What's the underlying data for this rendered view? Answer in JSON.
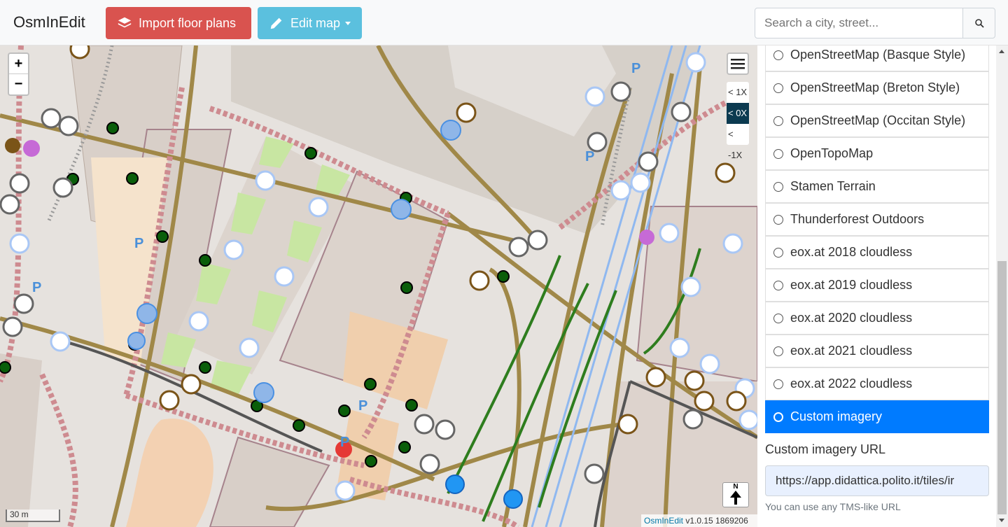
{
  "app": {
    "brand": "OsmInEdit",
    "import_label": "Import floor plans",
    "edit_label": "Edit map",
    "search_placeholder": "Search a city, street..."
  },
  "map": {
    "zoom_in": "+",
    "zoom_out": "−",
    "levels": [
      {
        "label": "< 1X",
        "active": false
      },
      {
        "label": "< 0X",
        "active": true
      },
      {
        "label": "< -1X",
        "active": false
      }
    ],
    "north_label": "N",
    "scale_label": "30 m",
    "attribution_link": "OsmInEdit",
    "attribution_version": " v1.0.15 1869206"
  },
  "panel": {
    "layers": [
      {
        "label": "OpenStreetMap (Basque Style)",
        "selected": false
      },
      {
        "label": "OpenStreetMap (Breton Style)",
        "selected": false
      },
      {
        "label": "OpenStreetMap (Occitan Style)",
        "selected": false
      },
      {
        "label": "OpenTopoMap",
        "selected": false
      },
      {
        "label": "Stamen Terrain",
        "selected": false
      },
      {
        "label": "Thunderforest Outdoors",
        "selected": false
      },
      {
        "label": "eox.at 2018 cloudless",
        "selected": false
      },
      {
        "label": "eox.at 2019 cloudless",
        "selected": false
      },
      {
        "label": "eox.at 2020 cloudless",
        "selected": false
      },
      {
        "label": "eox.at 2021 cloudless",
        "selected": false
      },
      {
        "label": "eox.at 2022 cloudless",
        "selected": false
      },
      {
        "label": "Custom imagery",
        "selected": true
      }
    ],
    "custom_url_label": "Custom imagery URL",
    "custom_url_value": "https://app.didattica.polito.it/tiles/ir",
    "custom_url_help": "You can use any TMS-like URL"
  }
}
